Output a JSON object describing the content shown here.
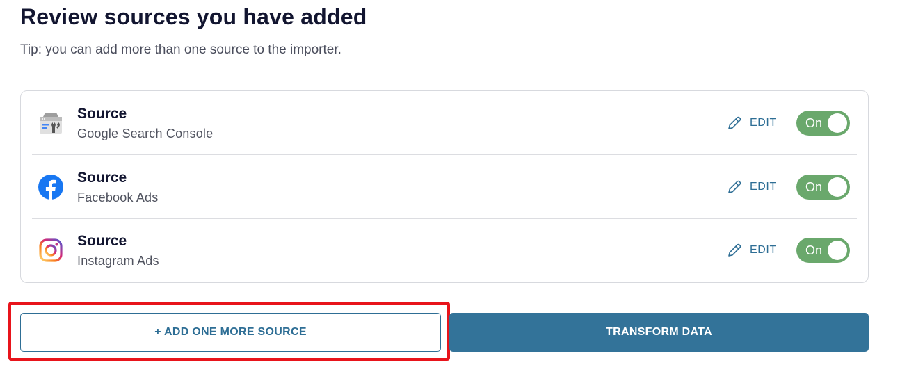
{
  "header": {
    "title": "Review sources you have added",
    "tip": "Tip: you can add more than one source to the importer."
  },
  "sources": [
    {
      "label": "Source",
      "name": "Google Search Console",
      "icon": "google-search-console-icon",
      "edit_label": "EDIT",
      "toggle_label": "On",
      "enabled": true
    },
    {
      "label": "Source",
      "name": "Facebook Ads",
      "icon": "facebook-icon",
      "edit_label": "EDIT",
      "toggle_label": "On",
      "enabled": true
    },
    {
      "label": "Source",
      "name": "Instagram Ads",
      "icon": "instagram-icon",
      "edit_label": "EDIT",
      "toggle_label": "On",
      "enabled": true
    }
  ],
  "actions": {
    "add_label": "+ ADD ONE MORE SOURCE",
    "transform_label": "TRANSFORM DATA"
  },
  "colors": {
    "accent": "#2e6e95",
    "primary_button": "#337399",
    "toggle_on": "#6aa86c",
    "highlight": "#e8141b"
  }
}
